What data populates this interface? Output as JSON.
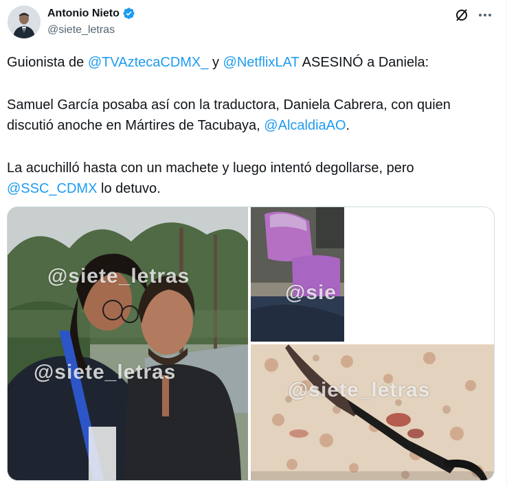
{
  "author": {
    "name": "Antonio Nieto",
    "handle": "@siete_letras",
    "verified": true,
    "avatar_icon": "person-avatar"
  },
  "actions": {
    "grok_icon": "grok-icon",
    "more_icon": "more-icon"
  },
  "tweet": {
    "p1_text1": "Guionista de ",
    "p1_mention1": "@TVAztecaCDMX_",
    "p1_text2": " y ",
    "p1_mention2": "@NetflixLAT",
    "p1_text3": " ASESINÓ a Daniela:",
    "p2_text1": "Samuel García posaba así con la traductora, Daniela Cabrera, con quien discutió anoche en Mártires de Tacubaya, ",
    "p2_mention": "@AlcaldiaAO",
    "p2_text2": ".",
    "p3_text1": "La acuchilló hasta con un machete y luego intentó degollarse, pero ",
    "p3_mention": "@SSC_CDMX",
    "p3_text2": " lo detuvo."
  },
  "media": {
    "watermark1": "@siete_letras",
    "watermark2": "@siete_letras",
    "watermark3": "@sie",
    "watermark4": "@siete_letras"
  },
  "colors": {
    "accent": "#1d9bf0",
    "text": "#0f1419",
    "secondary": "#536471"
  }
}
